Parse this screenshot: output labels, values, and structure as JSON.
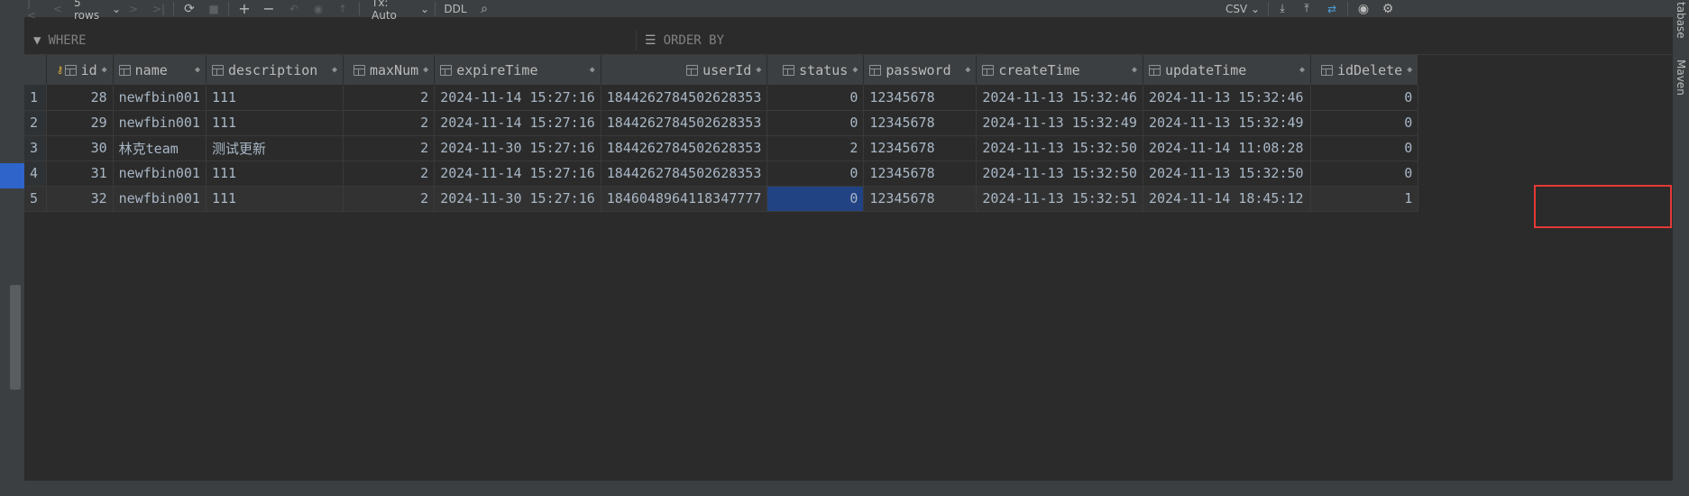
{
  "toolbar": {
    "rows_label": "5 rows",
    "tx_label": "Tx: Auto",
    "ddl_label": "DDL",
    "csv_label": "CSV"
  },
  "filters": {
    "where_placeholder": "WHERE",
    "order_placeholder": "ORDER BY"
  },
  "table": {
    "columns": [
      "id",
      "name",
      "description",
      "maxNum",
      "expireTime",
      "userId",
      "status",
      "password",
      "createTime",
      "updateTime",
      "idDelete"
    ],
    "rows": [
      {
        "rownum": "1",
        "id": "28",
        "name": "newfbin001",
        "description": "111",
        "maxNum": "2",
        "expireTime": "2024-11-14 15:27:16",
        "userId": "1844262784502628353",
        "status": "0",
        "password": "12345678",
        "createTime": "2024-11-13 15:32:46",
        "updateTime": "2024-11-13 15:32:46",
        "idDelete": "0"
      },
      {
        "rownum": "2",
        "id": "29",
        "name": "newfbin001",
        "description": "111",
        "maxNum": "2",
        "expireTime": "2024-11-14 15:27:16",
        "userId": "1844262784502628353",
        "status": "0",
        "password": "12345678",
        "createTime": "2024-11-13 15:32:49",
        "updateTime": "2024-11-13 15:32:49",
        "idDelete": "0"
      },
      {
        "rownum": "3",
        "id": "30",
        "name": "林克team",
        "description": "测试更新",
        "maxNum": "2",
        "expireTime": "2024-11-30 15:27:16",
        "userId": "1844262784502628353",
        "status": "2",
        "password": "12345678",
        "createTime": "2024-11-13 15:32:50",
        "updateTime": "2024-11-14 11:08:28",
        "idDelete": "0"
      },
      {
        "rownum": "4",
        "id": "31",
        "name": "newfbin001",
        "description": "111",
        "maxNum": "2",
        "expireTime": "2024-11-14 15:27:16",
        "userId": "1844262784502628353",
        "status": "0",
        "password": "12345678",
        "createTime": "2024-11-13 15:32:50",
        "updateTime": "2024-11-13 15:32:50",
        "idDelete": "0"
      },
      {
        "rownum": "5",
        "id": "32",
        "name": "newfbin001",
        "description": "111",
        "maxNum": "2",
        "expireTime": "2024-11-30 15:27:16",
        "userId": "1846048964118347777",
        "status": "0",
        "password": "12345678",
        "createTime": "2024-11-13 15:32:51",
        "updateTime": "2024-11-14 18:45:12",
        "idDelete": "1"
      }
    ]
  },
  "side_tabs": {
    "database": "tabase",
    "maven": "Maven"
  },
  "colors": {
    "background": "#2b2b2b",
    "header": "#3c3f41",
    "selection": "#214283",
    "annotation": "#e53935"
  }
}
